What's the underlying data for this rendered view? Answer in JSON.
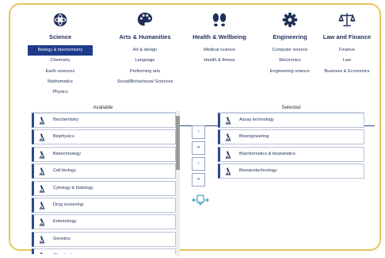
{
  "categories": [
    {
      "title": "Science",
      "icon": "atom-icon",
      "items": [
        "Biology & biochemistry",
        "Chemistry",
        "Earth sciences",
        "Mathematics",
        "Physics"
      ],
      "active": 0
    },
    {
      "title": "Arts & Humanities",
      "icon": "palette-icon",
      "items": [
        "Art & design",
        "Language",
        "Performing arts",
        "Social/Behavioural Sciences"
      ],
      "active": -1
    },
    {
      "title": "Health & Wellbeing",
      "icon": "footprints-icon",
      "items": [
        "Medical science",
        "Health & fitness"
      ],
      "active": -1
    },
    {
      "title": "Engineering",
      "icon": "gear-icon",
      "items": [
        "Computer science",
        "Electronics",
        "Engineering science"
      ],
      "active": -1
    },
    {
      "title": "Law and Finance",
      "icon": "scales-icon",
      "items": [
        "Finance",
        "Law",
        "Business & Economics"
      ],
      "active": -1
    }
  ],
  "available": {
    "label": "Available",
    "items": [
      "Biochemistry",
      "Biophysics",
      "Biotechnology",
      "Cell biology",
      "Cytology & histology",
      "Drug screening",
      "Entomology",
      "Genetics",
      "Glycobiology"
    ]
  },
  "selected": {
    "label": "Selected",
    "items": [
      "Assay technology",
      "Bioengineering",
      "Bioinformatics & biostatistics",
      "Bionanotechnology"
    ]
  },
  "controls": {
    "move_right": "›",
    "move_all_right": "»",
    "move_left": "‹",
    "move_all_left": "«"
  },
  "colors": {
    "accent": "#1e3a8a",
    "border": "#e8c560"
  }
}
